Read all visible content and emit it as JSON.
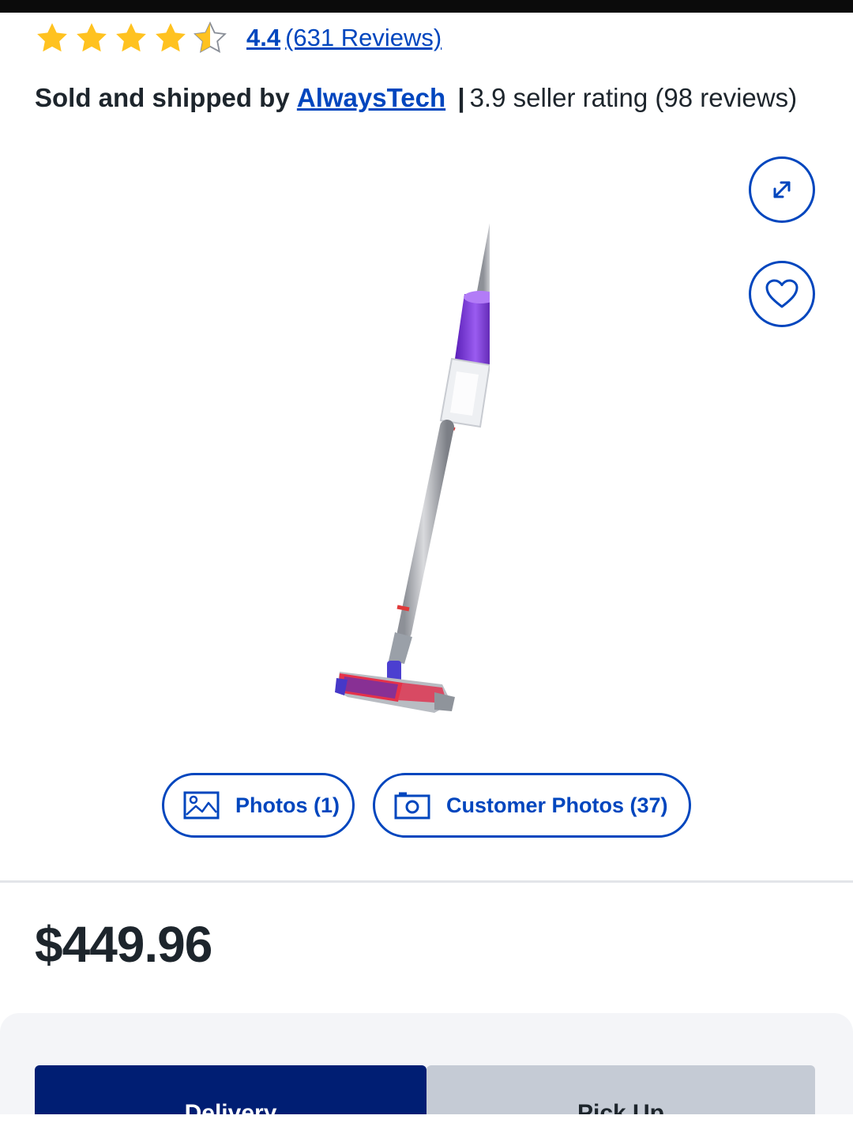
{
  "rating": {
    "stars": [
      {
        "icon": "star-filled-icon",
        "fill": 1
      },
      {
        "icon": "star-filled-icon",
        "fill": 1
      },
      {
        "icon": "star-filled-icon",
        "fill": 1
      },
      {
        "icon": "star-filled-icon",
        "fill": 1
      },
      {
        "icon": "star-half-icon",
        "fill": 0.5
      }
    ],
    "value": "4.4",
    "reviews_label": "(631 Reviews)",
    "star_color": "#ffc220"
  },
  "seller": {
    "prefix": "Sold and shipped by",
    "name": "AlwaysTech",
    "separator": "|",
    "rating_text": "3.9 seller rating (98 reviews)"
  },
  "product": {
    "image_icon": "stick-vacuum-image"
  },
  "actions": {
    "expand_icon": "expand-icon",
    "favorite_icon": "heart-icon"
  },
  "media_buttons": {
    "photos_label": "Photos (1)",
    "customer_photos_label": "Customer Photos (37)"
  },
  "price": "$449.96",
  "fulfillment": {
    "tabs": [
      {
        "label": "Delivery",
        "selected": true
      },
      {
        "label": "Pick Up",
        "selected": false
      }
    ]
  },
  "colors": {
    "link_blue": "#0046be",
    "tab_selected": "#001e73",
    "tab_unselected": "#c5cbd5",
    "text": "#1d252c"
  }
}
